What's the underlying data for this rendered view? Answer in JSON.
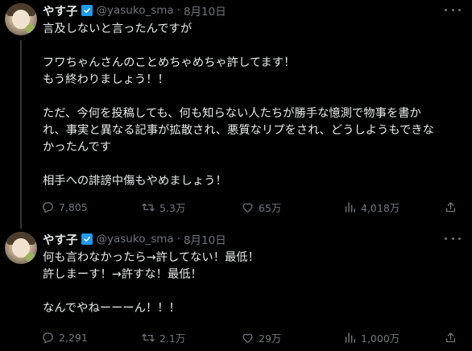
{
  "tweets": [
    {
      "author": {
        "name": "やす子",
        "handle": "@yasuko_sma",
        "date": "8月10日"
      },
      "separator": "·",
      "paragraphs": [
        [
          "言及しないと言ったんですが"
        ],
        [
          "フワちゃんさんのことめちゃめちゃ許してます！",
          "もう終わりましょう！！"
        ],
        [
          "ただ、今何を投稿しても、何も知らない人たちが勝手な憶測で物事を書か",
          "れ、事実と異なる記事が拡散され、悪質なリプをされ、どうしようもできな",
          "かったんです"
        ],
        [
          "相手への誹謗中傷もやめましょう！"
        ]
      ],
      "stats": {
        "replies": "7,805",
        "retweets": "5.3万",
        "likes": "65万",
        "views": "4,018万"
      }
    },
    {
      "author": {
        "name": "やす子",
        "handle": "@yasuko_sma",
        "date": "8月10日"
      },
      "separator": "·",
      "paragraphs": [
        [
          "何も言わなかったら→許してない！最低！",
          "許しまーす！→許すな！最低！"
        ],
        [
          "なんでやねーーーん！！！"
        ]
      ],
      "stats": {
        "replies": "2,291",
        "retweets": "2.1万",
        "likes": "29万",
        "views": "1,000万"
      }
    }
  ],
  "icons": {
    "verified": "verified-badge-icon",
    "more": "more-icon",
    "reply": "reply-icon",
    "retweet": "retweet-icon",
    "like": "like-icon",
    "views": "views-icon",
    "share": "share-icon"
  },
  "colors": {
    "background": "#000000",
    "text": "#e7e9ea",
    "secondary_text": "#71767b",
    "verified_blue": "#1d9bf0",
    "thread_line": "#333639"
  }
}
